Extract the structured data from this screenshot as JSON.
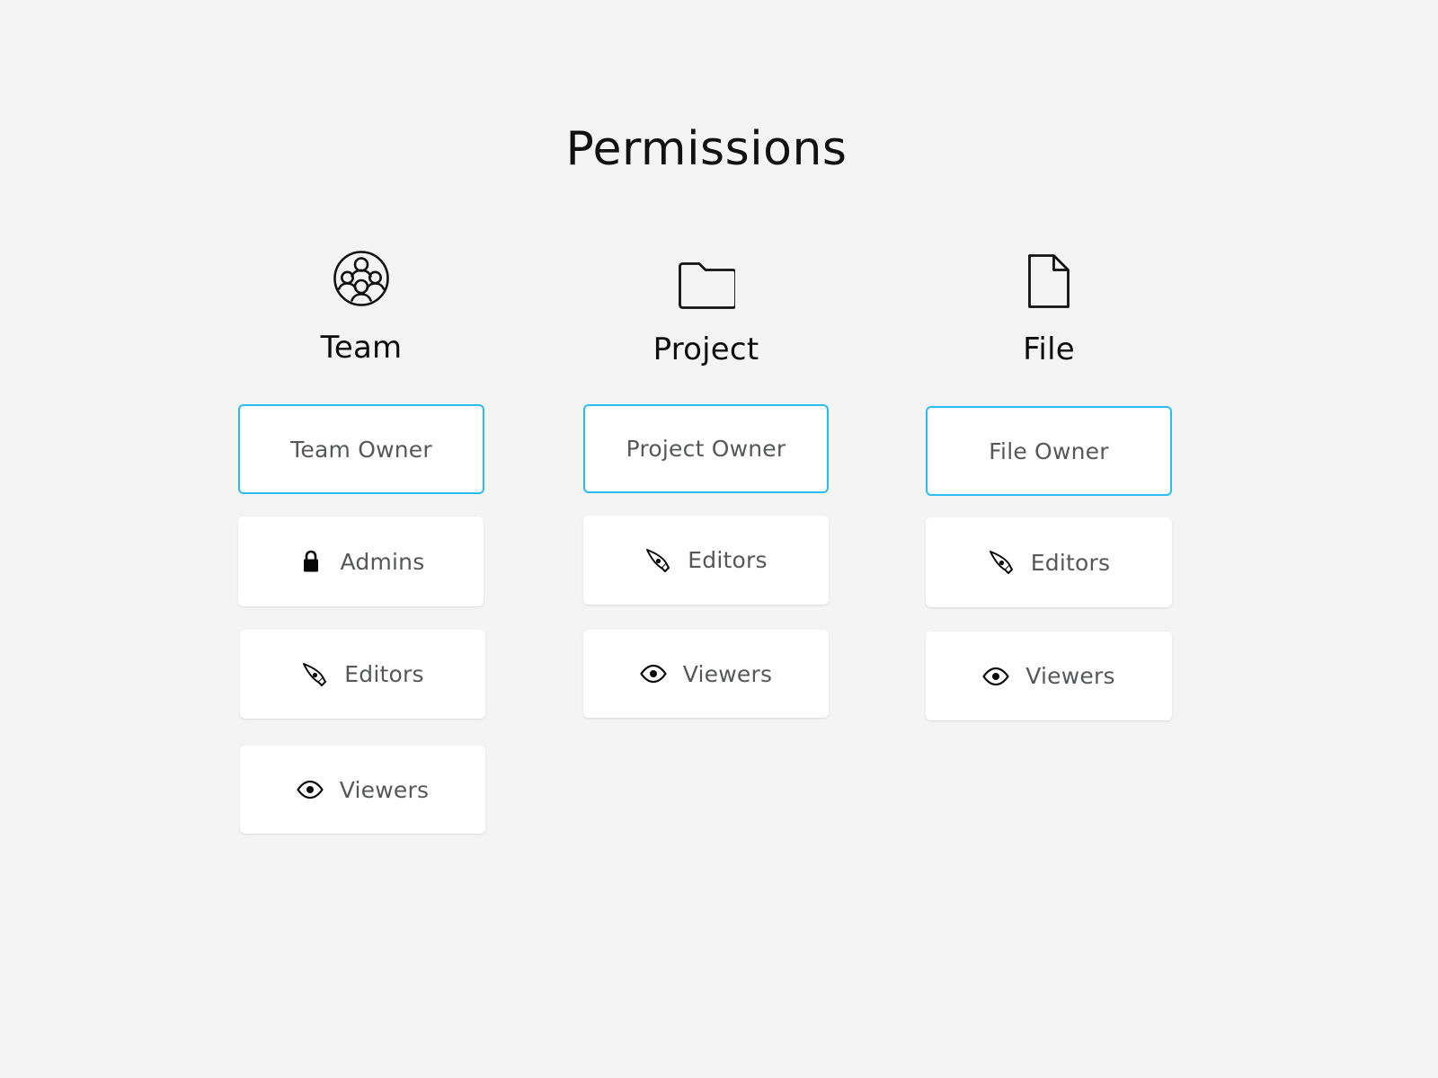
{
  "page": {
    "title": "Permissions",
    "background_color": "#f4f4f4",
    "accent_color": "#29bcf5",
    "card_background": "#ffffff",
    "card_text_color": "#555759",
    "heading_color": "#0d0d0d"
  },
  "columns": [
    {
      "id": "team",
      "label": "Team",
      "icon": "team-circle-icon",
      "cards": [
        {
          "label": "Team Owner",
          "icon": "none",
          "owner": true
        },
        {
          "label": "Admins",
          "icon": "lock-icon",
          "owner": false
        },
        {
          "label": "Editors",
          "icon": "pen-nib-icon",
          "owner": false
        },
        {
          "label": "Viewers",
          "icon": "eye-icon",
          "owner": false
        }
      ]
    },
    {
      "id": "project",
      "label": "Project",
      "icon": "folder-icon",
      "cards": [
        {
          "label": "Project Owner",
          "icon": "none",
          "owner": true
        },
        {
          "label": "Editors",
          "icon": "pen-nib-icon",
          "owner": false
        },
        {
          "label": "Viewers",
          "icon": "eye-icon",
          "owner": false
        }
      ]
    },
    {
      "id": "file",
      "label": "File",
      "icon": "file-document-icon",
      "cards": [
        {
          "label": "File Owner",
          "icon": "none",
          "owner": true
        },
        {
          "label": "Editors",
          "icon": "pen-nib-icon",
          "owner": false
        },
        {
          "label": "Viewers",
          "icon": "eye-icon",
          "owner": false
        }
      ]
    }
  ]
}
